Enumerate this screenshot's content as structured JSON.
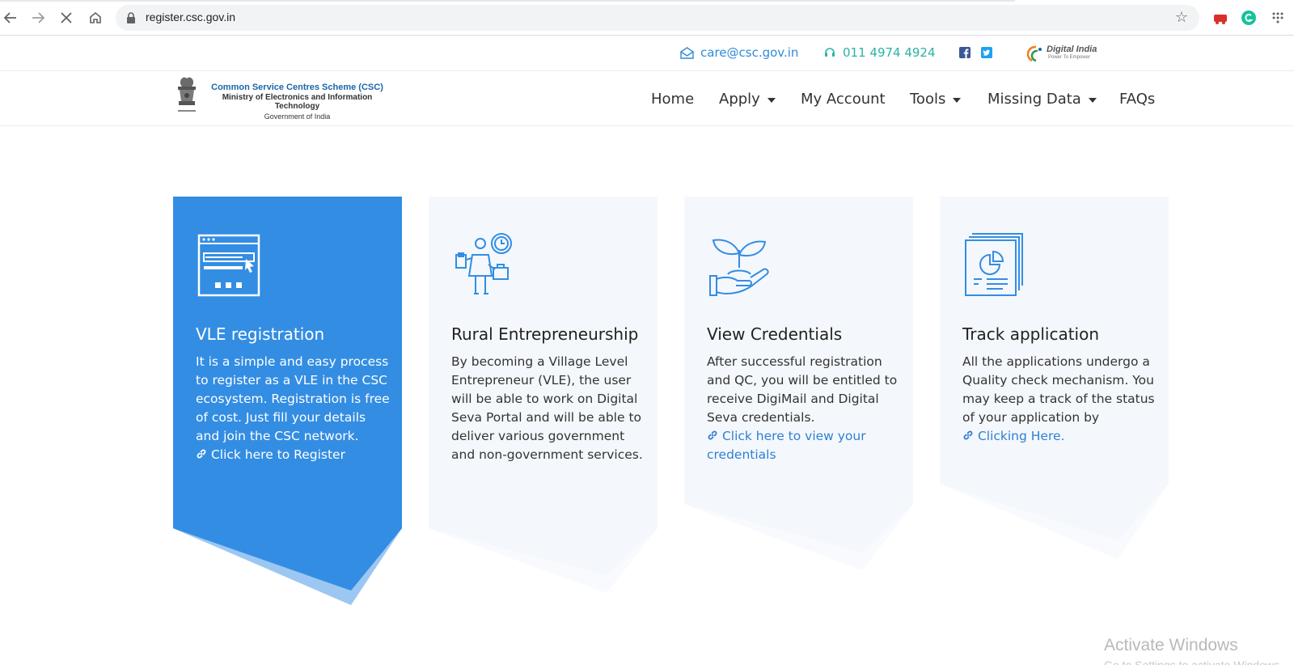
{
  "browser": {
    "url": "register.csc.gov.in"
  },
  "topbar": {
    "email": "care@csc.gov.in",
    "phone": "011 4974 4924"
  },
  "brand": {
    "line1": "Common Service Centres Scheme (CSC)",
    "line2": "Ministry of Electronics and Information Technology",
    "line3": "Government of India",
    "partner": "Digital India",
    "partner_tagline": "Power To Empower"
  },
  "nav": {
    "home": "Home",
    "apply": "Apply",
    "my_account": "My Account",
    "tools": "Tools",
    "missing_data": "Missing Data",
    "faqs": "FAQs"
  },
  "cards": [
    {
      "title": "VLE registration",
      "desc": "It is a simple and easy process to register as a VLE in the CSC ecosystem. Registration is free of cost. Just fill your details and join the CSC network.",
      "link": "Click here to Register"
    },
    {
      "title": "Rural Entrepreneurship",
      "desc": "By becoming a Village Level Entrepreneur (VLE), the user will be able to work on Digital Seva Portal and will be able to deliver various government and non-government services.",
      "link": ""
    },
    {
      "title": "View Credentials",
      "desc": "After successful registration and QC, you will be entitled to receive DigiMail and Digital Seva credentials.",
      "link": "Click here to view your credentials"
    },
    {
      "title": "Track application",
      "desc": "All the applications undergo a Quality check mechanism. You may keep a track of the status of your application by",
      "link": "Clicking Here."
    }
  ],
  "watermark": {
    "line1": "Activate Windows",
    "line2": "Go to Settings to activate Windows."
  },
  "colors": {
    "primary": "#338de3",
    "card_bg": "#f4f8fc",
    "link": "#2f7fd3",
    "teal": "#2bb3a3"
  }
}
